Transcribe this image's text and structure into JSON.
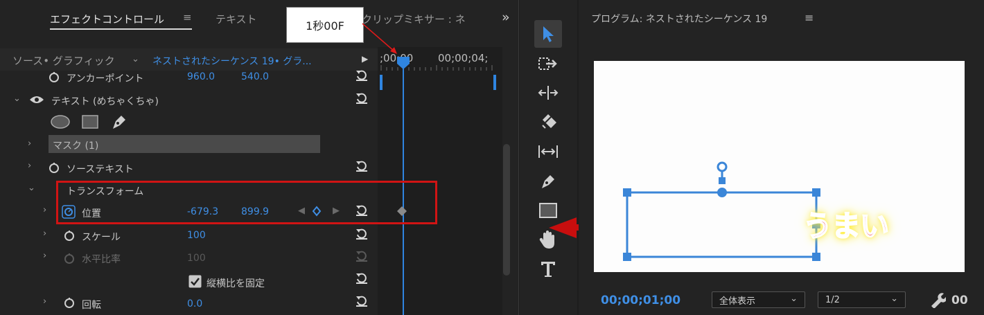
{
  "effect_controls": {
    "tabs": [
      {
        "label": "エフェクトコントロール",
        "menu_glyph": "≡",
        "active": true
      },
      {
        "label": "テキスト"
      },
      {
        "label": "クリップミキサー : ネ"
      }
    ],
    "overflow_glyph": "»",
    "source_label": "ソース• グラフィック",
    "sequence_label": "ネストされたシーケンス 19• グラ...",
    "play_glyph": "▶",
    "ruler_ticks": [
      ";00;00",
      "00;00;04;"
    ],
    "rows": {
      "anchor": {
        "label": "アンカーポイント",
        "x": "960.0",
        "y": "540.0"
      },
      "text_group": {
        "label": "テキスト (めちゃくちゃ)"
      },
      "mask": {
        "label": "マスク (1)"
      },
      "source_text": {
        "label": "ソーステキスト"
      },
      "transform": {
        "label": "トランスフォーム"
      },
      "position": {
        "label": "位置",
        "x": "-679.3",
        "y": "899.9"
      },
      "scale": {
        "label": "スケール",
        "value": "100"
      },
      "horizontal_scale": {
        "label": "水平比率",
        "value": "100"
      },
      "lock_ratio": {
        "label": "縦横比を固定"
      },
      "rotation": {
        "label": "回転",
        "value": "0.0"
      }
    },
    "callout": "1秒00F"
  },
  "program_monitor": {
    "title": "プログラム: ネストされたシーケンス 19",
    "menu_glyph": "≡",
    "timecode": "00;00;01;00",
    "zoom": "全体表示",
    "resolution": "1/2",
    "right_tc": "00",
    "canvas_text": "うまい"
  },
  "colors": {
    "accent": "#3f8fe6",
    "highlight": "#d01414"
  }
}
